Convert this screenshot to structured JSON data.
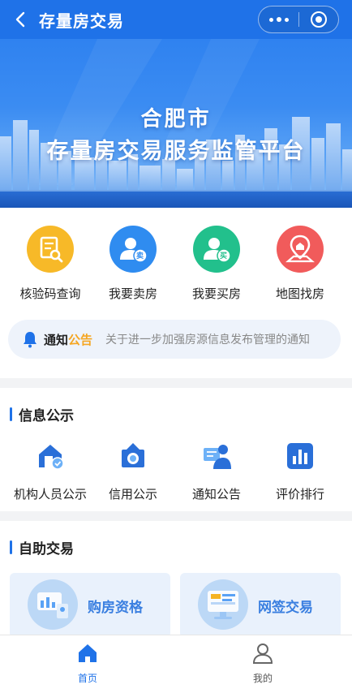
{
  "nav": {
    "title": "存量房交易"
  },
  "banner": {
    "line1": "合肥市",
    "line2": "存量房交易服务监管平台"
  },
  "quick_actions": [
    {
      "label": "核验码查询",
      "icon": "document-search-icon",
      "color": "#f5b323"
    },
    {
      "label": "我要卖房",
      "icon": "sell-user-icon",
      "color": "#2f8cf0",
      "badge": "卖"
    },
    {
      "label": "我要买房",
      "icon": "buy-user-icon",
      "color": "#21c08b",
      "badge": "买"
    },
    {
      "label": "地图找房",
      "icon": "map-pin-icon",
      "color": "#f05a5a"
    }
  ],
  "notice": {
    "tag1": "通知",
    "tag2": "公告",
    "text": "关于进一步加强房源信息发布管理的通知"
  },
  "info_section": {
    "title": "信息公示",
    "items": [
      {
        "label": "机构人员公示",
        "icon": "agency-house-icon"
      },
      {
        "label": "信用公示",
        "icon": "credit-badge-icon"
      },
      {
        "label": "通知公告",
        "icon": "announcement-person-icon"
      },
      {
        "label": "评价排行",
        "icon": "bar-chart-icon"
      }
    ]
  },
  "self_section": {
    "title": "自助交易",
    "tiles": [
      {
        "label": "购房资格",
        "icon": "qualification-icon"
      },
      {
        "label": "网签交易",
        "icon": "contract-monitor-icon"
      }
    ]
  },
  "tabs": [
    {
      "label": "首页",
      "icon": "home-icon",
      "active": true
    },
    {
      "label": "我的",
      "icon": "user-icon",
      "active": false
    }
  ],
  "colors": {
    "primary": "#1f72e8",
    "accent": "#f5a623"
  }
}
